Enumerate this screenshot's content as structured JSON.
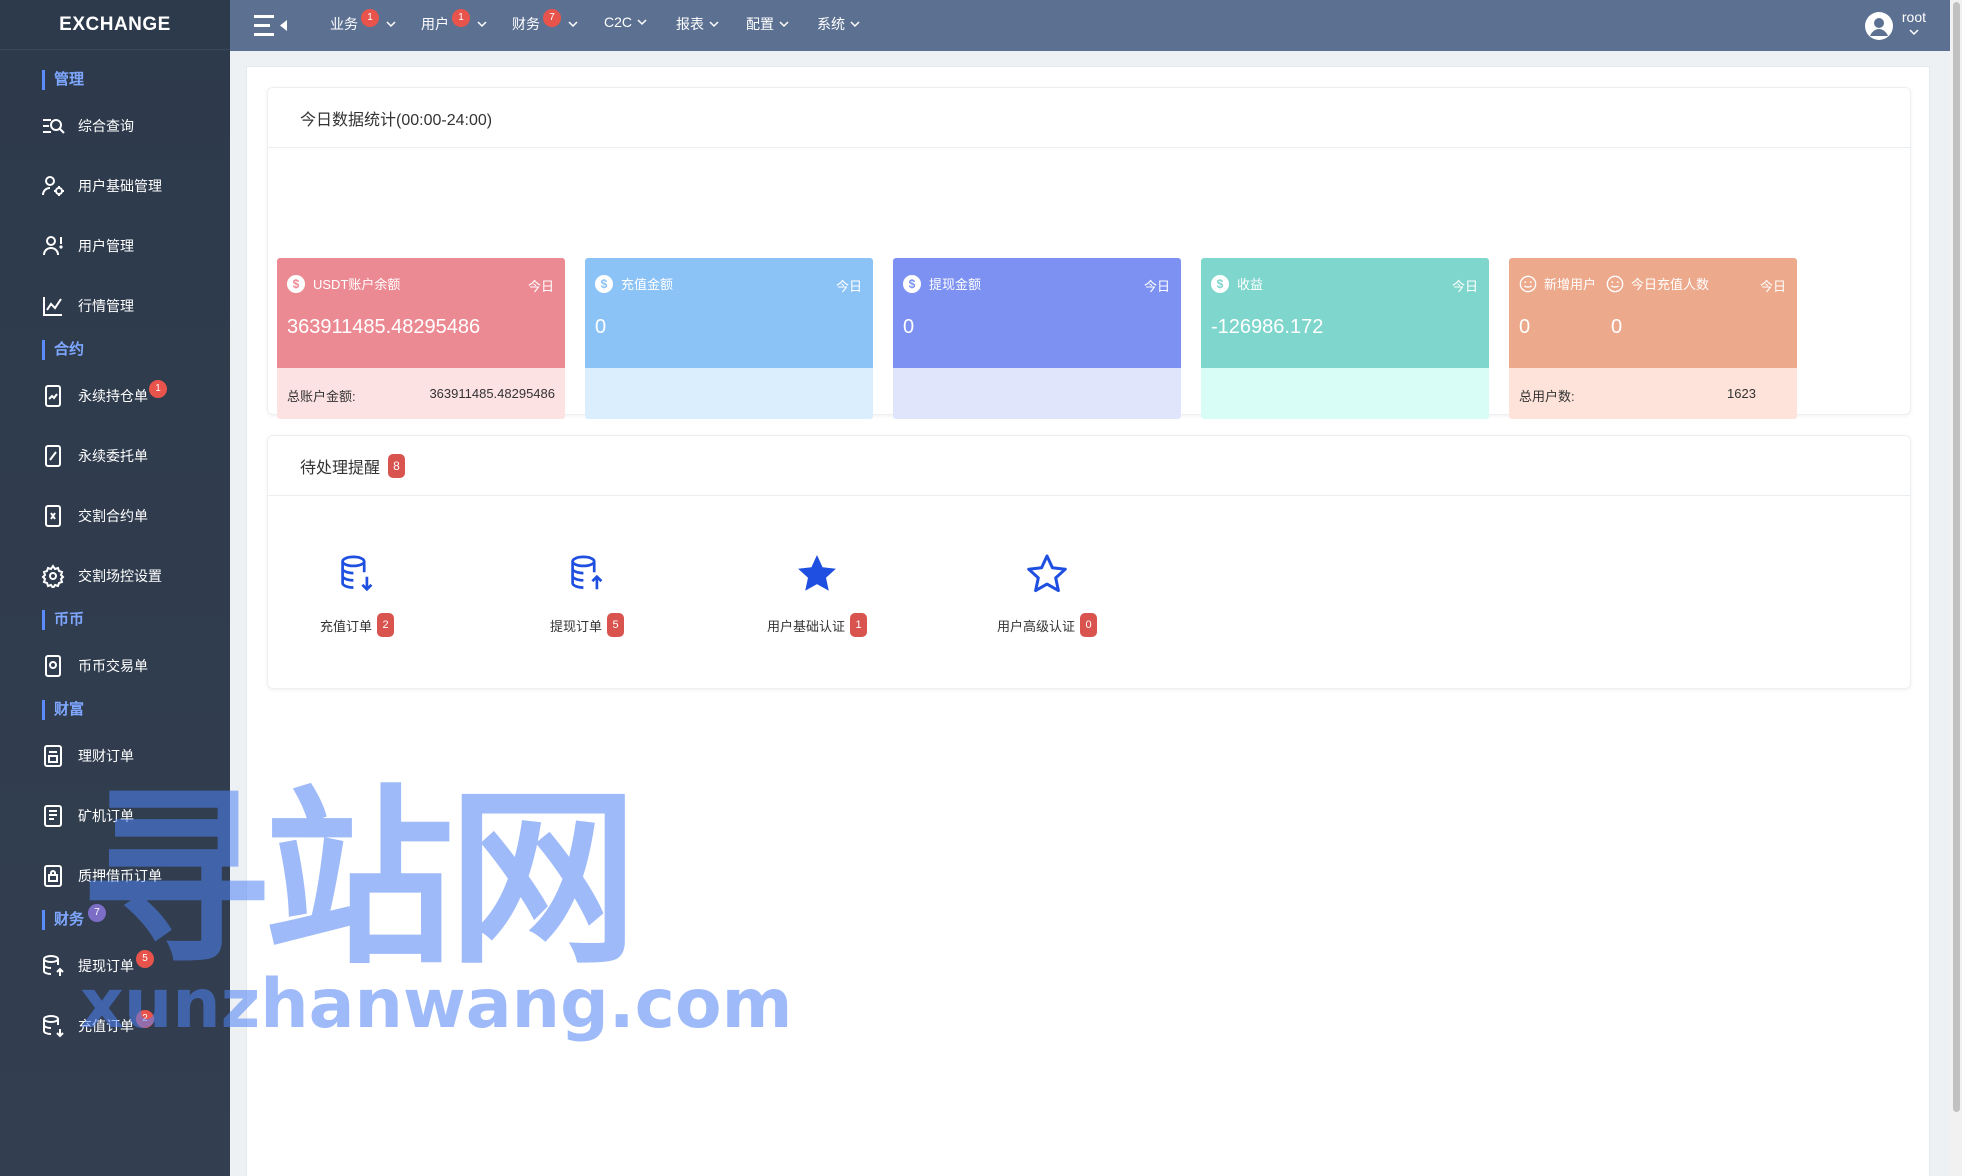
{
  "sidebar": {
    "brand": "EXCHANGE",
    "sections": [
      {
        "title": "管理"
      },
      {
        "title": "合约"
      },
      {
        "title": "币币"
      },
      {
        "title": "财富"
      },
      {
        "title": "财务",
        "badge": "7"
      }
    ],
    "items": [
      {
        "label": "综合查询",
        "icon": "search-list-icon"
      },
      {
        "label": "用户基础管理",
        "icon": "user-settings-icon"
      },
      {
        "label": "用户管理",
        "icon": "user-alert-icon"
      },
      {
        "label": "行情管理",
        "icon": "chart-line-icon"
      },
      {
        "label": "永续持仓单",
        "icon": "phone-chart-icon",
        "badge": "1"
      },
      {
        "label": "永续委托单",
        "icon": "phone-chart-icon"
      },
      {
        "label": "交割合约单",
        "icon": "phone-dollar-icon"
      },
      {
        "label": "交割场控设置",
        "icon": "gear-icon"
      },
      {
        "label": "币币交易单",
        "icon": "phone-coin-icon"
      },
      {
        "label": "理财订单",
        "icon": "document-list-icon"
      },
      {
        "label": "矿机订单",
        "icon": "document-list-icon"
      },
      {
        "label": "质押借币订单",
        "icon": "document-lock-icon"
      },
      {
        "label": "提现订单",
        "icon": "database-up-icon",
        "badge": "5"
      },
      {
        "label": "充值订单",
        "icon": "database-down-icon",
        "badge": "2"
      }
    ]
  },
  "topbar": {
    "nav": [
      {
        "label": "业务",
        "badge": "1"
      },
      {
        "label": "用户",
        "badge": "1"
      },
      {
        "label": "财务",
        "badge": "7"
      },
      {
        "label": "C2C",
        "badge": ""
      },
      {
        "label": "报表",
        "badge": ""
      },
      {
        "label": "配置",
        "badge": ""
      },
      {
        "label": "系统",
        "badge": ""
      }
    ],
    "user": "root"
  },
  "stats": {
    "title": "今日数据统计(00:00-24:00)",
    "cards": [
      {
        "label": "USDT账户余额",
        "tag": "今日",
        "value": "363911485.48295486",
        "foot_label": "总账户金额:",
        "foot_value": "363911485.48295486",
        "color": "#ec8a93",
        "foot_color": "#fde2e4"
      },
      {
        "label": "充值金额",
        "tag": "今日",
        "value": "0",
        "color": "#8cc3f7",
        "foot_color": "#dbeefe"
      },
      {
        "label": "提现金额",
        "tag": "今日",
        "value": "0",
        "color": "#7c91f1",
        "foot_color": "#e1e5fb"
      },
      {
        "label": "收益",
        "tag": "今日",
        "value": "-126986.172",
        "color": "#7fd6cc",
        "foot_color": "#d8fcf6"
      },
      {
        "label": "新增用户",
        "label2": "今日充值人数",
        "tag": "今日",
        "value": "0",
        "value2": "0",
        "foot_label": "总用户数:",
        "foot_value": "1623",
        "color": "#eda98c",
        "foot_color": "#fde3da"
      }
    ]
  },
  "pending": {
    "title": "待处理提醒",
    "badge": "8",
    "items": [
      {
        "label": "充值订单",
        "badge": "2",
        "icon": "database-download-icon"
      },
      {
        "label": "提现订单",
        "badge": "5",
        "icon": "database-upload-icon"
      },
      {
        "label": "用户基础认证",
        "badge": "1",
        "icon": "star-filled-icon"
      },
      {
        "label": "用户高级认证",
        "badge": "0",
        "icon": "star-outline-icon"
      }
    ]
  },
  "watermark": {
    "big": "寻站网",
    "small": "xunzhanwang.com"
  }
}
